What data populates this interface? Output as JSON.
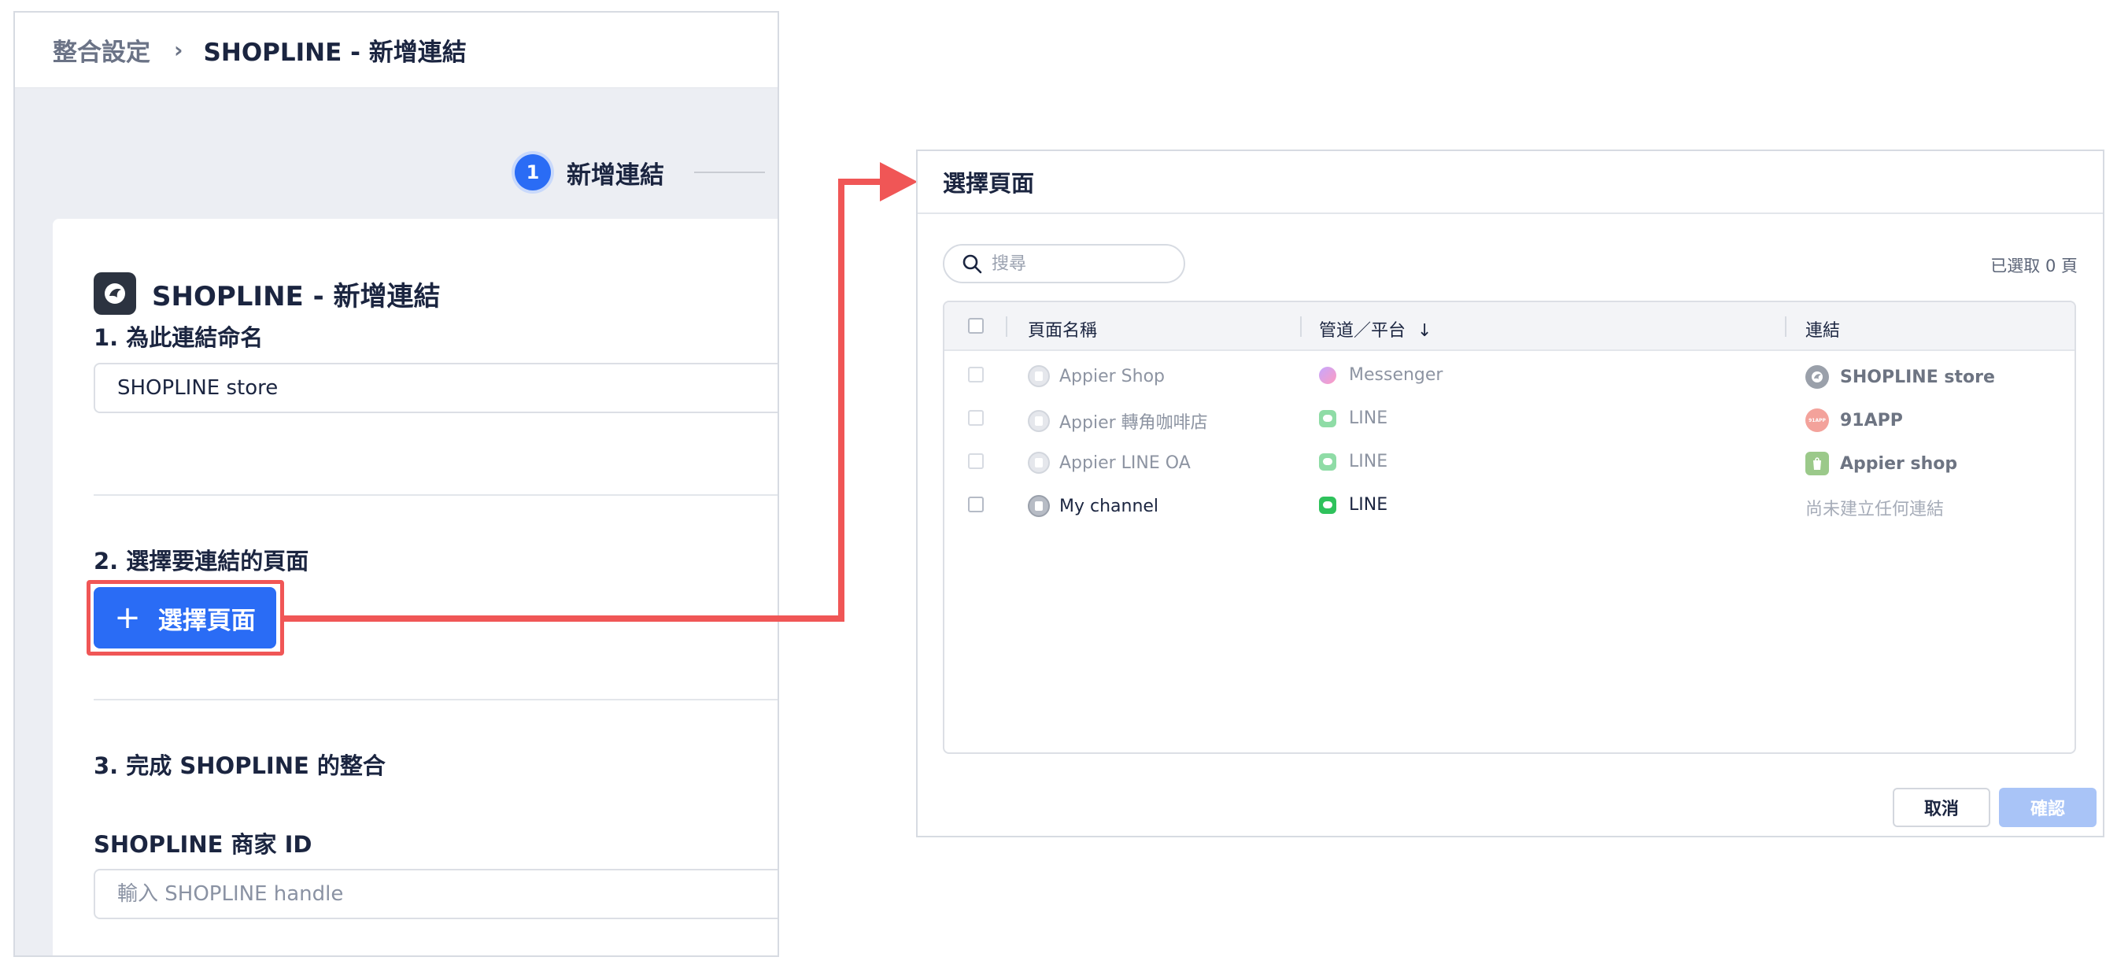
{
  "breadcrumb": {
    "root": "整合設定",
    "separator": "›",
    "current": "SHOPLINE - 新增連結"
  },
  "stepper": {
    "step_number": "1",
    "step_label": "新增連結"
  },
  "form": {
    "title": "SHOPLINE - 新增連結",
    "section1_label": "1. 為此連結命名",
    "name_value": "SHOPLINE store",
    "section2_label": "2. 選擇要連結的頁面",
    "select_button_label": "選擇頁面",
    "section3_label": "3. 完成 SHOPLINE 的整合",
    "merchant_id_label": "SHOPLINE 商家 ID",
    "merchant_id_placeholder": "輸入 SHOPLINE handle"
  },
  "dialog": {
    "title": "選擇頁面",
    "search_placeholder": "搜尋",
    "selected_count": "已選取 0 頁",
    "columns": {
      "page_name": "頁面名稱",
      "channel": "管道／平台",
      "sort_arrow": "↓",
      "link": "連結"
    },
    "rows": [
      {
        "page_name": "Appier Shop",
        "platform": "Messenger",
        "platform_icon": "messenger-icon",
        "link": "SHOPLINE store",
        "link_icon": "shopline-icon",
        "enabled": false
      },
      {
        "page_name": "Appier 轉角咖啡店",
        "platform": "LINE",
        "platform_icon": "line-icon",
        "link": "91APP",
        "link_icon": "91app-icon",
        "enabled": false
      },
      {
        "page_name": "Appier LINE OA",
        "platform": "LINE",
        "platform_icon": "line-icon",
        "link": "Appier shop",
        "link_icon": "shopify-icon",
        "enabled": false
      },
      {
        "page_name": "My channel",
        "platform": "LINE",
        "platform_icon": "line-icon",
        "link": "尚未建立任何連結",
        "link_icon": "",
        "enabled": true
      }
    ],
    "cancel_label": "取消",
    "confirm_label": "確認"
  },
  "colors": {
    "primary": "#2a6cf5",
    "highlight": "#f05656",
    "line_green": "#2fc25c",
    "confirm_disabled": "#a9c4f7"
  },
  "app_91_badge": "91APP"
}
